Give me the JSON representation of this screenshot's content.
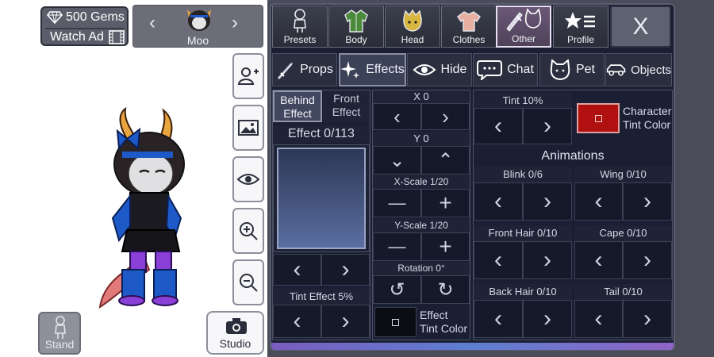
{
  "top": {
    "gems": "500 Gems",
    "watch_ad": "Watch Ad",
    "character_name": "Moo"
  },
  "buttons": {
    "stand": "Stand",
    "studio": "Studio"
  },
  "categories": [
    {
      "label": "Presets",
      "icon": "preset-person-icon"
    },
    {
      "label": "Body",
      "icon": "body-jacket-icon"
    },
    {
      "label": "Head",
      "icon": "head-face-icon"
    },
    {
      "label": "Clothes",
      "icon": "clothes-shirt-icon"
    },
    {
      "label": "Other",
      "icon": "other-sword-cat-icon",
      "active": true
    },
    {
      "label": "Profile",
      "icon": "profile-star-icon"
    }
  ],
  "subtabs": [
    {
      "label": "Props",
      "icon": "sword-icon"
    },
    {
      "label": "Effects",
      "icon": "sparkles-icon",
      "active": true
    },
    {
      "label": "Hide",
      "icon": "eye-icon"
    },
    {
      "label": "Chat",
      "icon": "chat-bubble-icon"
    },
    {
      "label": "Pet",
      "icon": "cat-icon"
    },
    {
      "label": "Objects",
      "icon": "car-icon"
    }
  ],
  "effects": {
    "behind_1": "Behind",
    "behind_2": "Effect",
    "front_1": "Front",
    "front_2": "Effect",
    "effect_counter": "Effect 0/113",
    "tint_effect": "Tint Effect 5%",
    "effect_tint_color_1": "Effect",
    "effect_tint_color_2": "Tint Color"
  },
  "transform": {
    "x": "X 0",
    "y": "Y 0",
    "x_scale": "X-Scale 1/20",
    "y_scale": "Y-Scale 1/20",
    "rotation": "Rotation 0°"
  },
  "tint": {
    "tint": "Tint 10%",
    "character_tint_1": "Character",
    "character_tint_2": "Tint Color",
    "character_tint_swatch": "#b01010"
  },
  "animations": {
    "title": "Animations",
    "blink": "Blink 0/6",
    "wing": "Wing 0/10",
    "front_hair": "Front Hair 0/10",
    "cape": "Cape 0/10",
    "back_hair": "Back Hair 0/10",
    "tail": "Tail 0/10"
  },
  "symbols": {
    "left": "‹",
    "right": "›",
    "up": "⌃",
    "down": "⌄",
    "minus": "—",
    "plus": "+",
    "rot_left": "↺",
    "rot_right": "↻",
    "close": "X"
  }
}
